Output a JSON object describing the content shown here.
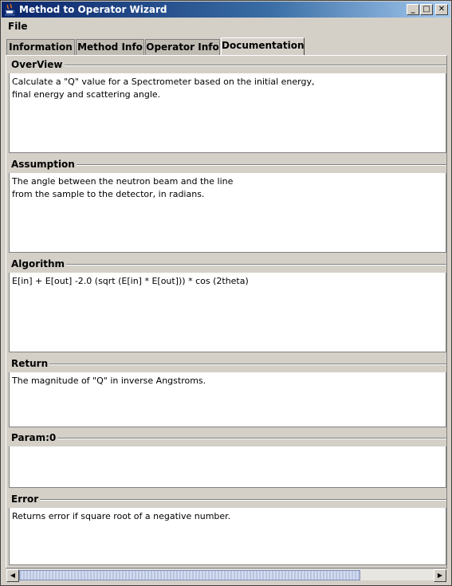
{
  "window": {
    "title": "Method to Operator Wizard",
    "controls": {
      "minimize": "_",
      "maximize": "□",
      "close": "✕"
    }
  },
  "menu": {
    "file": "File"
  },
  "tabs": [
    {
      "label": "Information",
      "selected": false
    },
    {
      "label": "Method Info",
      "selected": false
    },
    {
      "label": "Operator Info",
      "selected": false
    },
    {
      "label": "Documentation",
      "selected": true
    }
  ],
  "sections": {
    "overview": {
      "label": "OverView",
      "text": "Calculate a \"Q\" value for a Spectrometer based on the initial energy,\nfinal energy and scattering angle."
    },
    "assumption": {
      "label": "Assumption",
      "text": "The angle between the neutron beam and the line\nfrom the sample to the detector, in radians."
    },
    "algorithm": {
      "label": "Algorithm",
      "text": "E[in] + E[out] -2.0 (sqrt (E[in] * E[out])) * cos (2theta)"
    },
    "return": {
      "label": "Return",
      "text": "The magnitude of \"Q\" in inverse Angstroms."
    },
    "param0": {
      "label": "Param:0",
      "text": ""
    },
    "error": {
      "label": "Error",
      "text": "Returns error if square root of a negative number."
    }
  },
  "scrollbar": {
    "left_arrow": "◀",
    "right_arrow": "▶"
  },
  "colors": {
    "titlebar_start": "#0a246a",
    "titlebar_end": "#a6caf0",
    "panel": "#d4d0c8"
  }
}
